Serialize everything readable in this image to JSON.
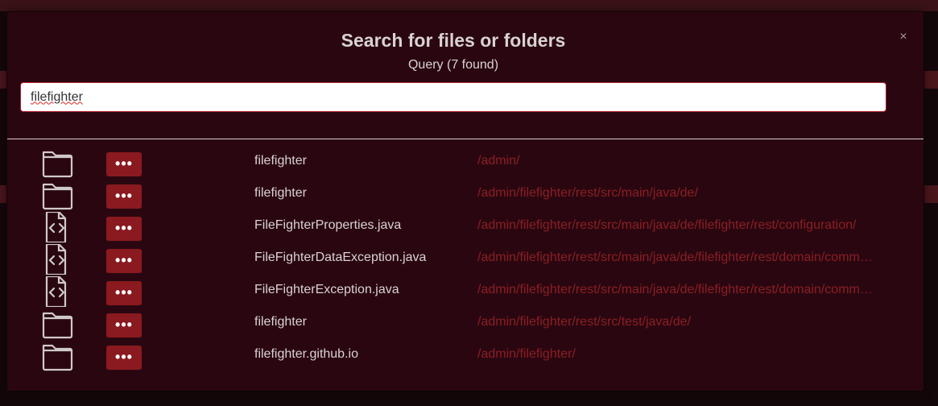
{
  "modal": {
    "title": "Search for files or folders",
    "subtitle": "Query (7 found)",
    "close_label": "×",
    "search": {
      "value": "filefighter",
      "placeholder": ""
    }
  },
  "results": [
    {
      "type": "folder",
      "icon": "folder-icon",
      "more_label": "•••",
      "name": "filefighter",
      "path": "/admin/"
    },
    {
      "type": "folder",
      "icon": "folder-icon",
      "more_label": "•••",
      "name": "filefighter",
      "path": "/admin/filefighter/rest/src/main/java/de/"
    },
    {
      "type": "file",
      "icon": "code-file-icon",
      "more_label": "•••",
      "name": "FileFighterProperties.java",
      "path": "/admin/filefighter/rest/src/main/java/de/filefighter/rest/configuration/"
    },
    {
      "type": "file",
      "icon": "code-file-icon",
      "more_label": "•••",
      "name": "FileFighterDataException.java",
      "path": "/admin/filefighter/rest/src/main/java/de/filefighter/rest/domain/comm…"
    },
    {
      "type": "file",
      "icon": "code-file-icon",
      "more_label": "•••",
      "name": "FileFighterException.java",
      "path": "/admin/filefighter/rest/src/main/java/de/filefighter/rest/domain/comm…"
    },
    {
      "type": "folder",
      "icon": "folder-icon",
      "more_label": "•••",
      "name": "filefighter",
      "path": "/admin/filefighter/rest/src/test/java/de/"
    },
    {
      "type": "folder",
      "icon": "folder-icon",
      "more_label": "•••",
      "name": "filefighter.github.io",
      "path": "/admin/filefighter/"
    }
  ],
  "colors": {
    "modal_background": "#2a0710",
    "accent": "#8a1a1f",
    "path_text": "#8b1e25",
    "text": "#d9d2d3"
  }
}
